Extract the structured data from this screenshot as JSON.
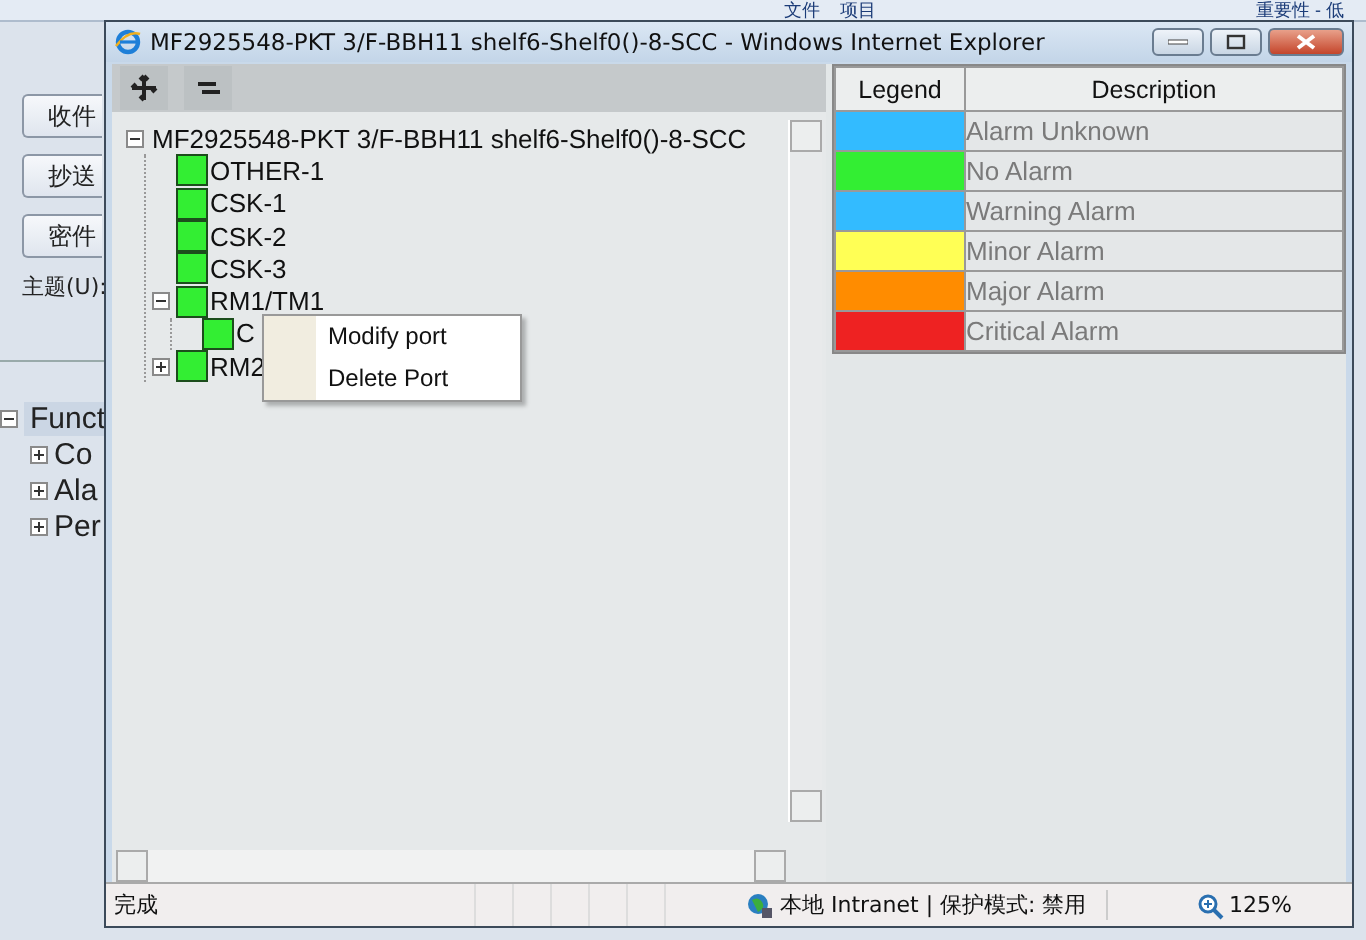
{
  "background_app": {
    "ribbon": [
      {
        "label": "文件"
      },
      {
        "label": "项目"
      },
      {
        "label": "重要性 - 低"
      }
    ],
    "buttons": [
      "收件",
      "抄送",
      "密件"
    ],
    "subject_label": "主题(U):",
    "tree": {
      "label": "Funct",
      "selected": true,
      "expanded": true,
      "children": [
        {
          "label": "Co",
          "expanded": false
        },
        {
          "label": "Ala",
          "expanded": false
        },
        {
          "label": "Per",
          "expanded": false
        }
      ]
    }
  },
  "window": {
    "title": "MF2925548-PKT 3/F-BBH11 shelf6-Shelf0()-8-SCC - Windows Internet Explorer",
    "tree": {
      "label": "MF2925548-PKT 3/F-BBH11 shelf6-Shelf0()-8-SCC",
      "expanded": true,
      "children": [
        {
          "label": "OTHER-1",
          "color": "#33ee33"
        },
        {
          "label": "CSK-1",
          "color": "#33ee33"
        },
        {
          "label": "CSK-2",
          "color": "#33ee33"
        },
        {
          "label": "CSK-3",
          "color": "#33ee33"
        },
        {
          "label": "RM1/TM1",
          "color": "#33ee33",
          "expanded": true,
          "children": [
            {
              "label": "C",
              "color": "#33ee33"
            }
          ]
        },
        {
          "label": "RM2",
          "color": "#33ee33",
          "expanded": false
        }
      ]
    },
    "legend": {
      "columns": [
        "Legend",
        "Description"
      ],
      "rows": [
        {
          "color": "#33bbff",
          "description": "Alarm Unknown"
        },
        {
          "color": "#33ee33",
          "description": "No Alarm"
        },
        {
          "color": "#33bbff",
          "description": "Warning Alarm"
        },
        {
          "color": "#ffff55",
          "description": "Minor Alarm"
        },
        {
          "color": "#ff8c00",
          "description": "Major Alarm"
        },
        {
          "color": "#ee2222",
          "description": "Critical Alarm"
        }
      ]
    },
    "context_menu": [
      "Modify port",
      "Delete Port"
    ],
    "status_bar": {
      "status": "完成",
      "zone": "本地 Intranet | 保护模式: 禁用",
      "zoom": "125%"
    }
  }
}
